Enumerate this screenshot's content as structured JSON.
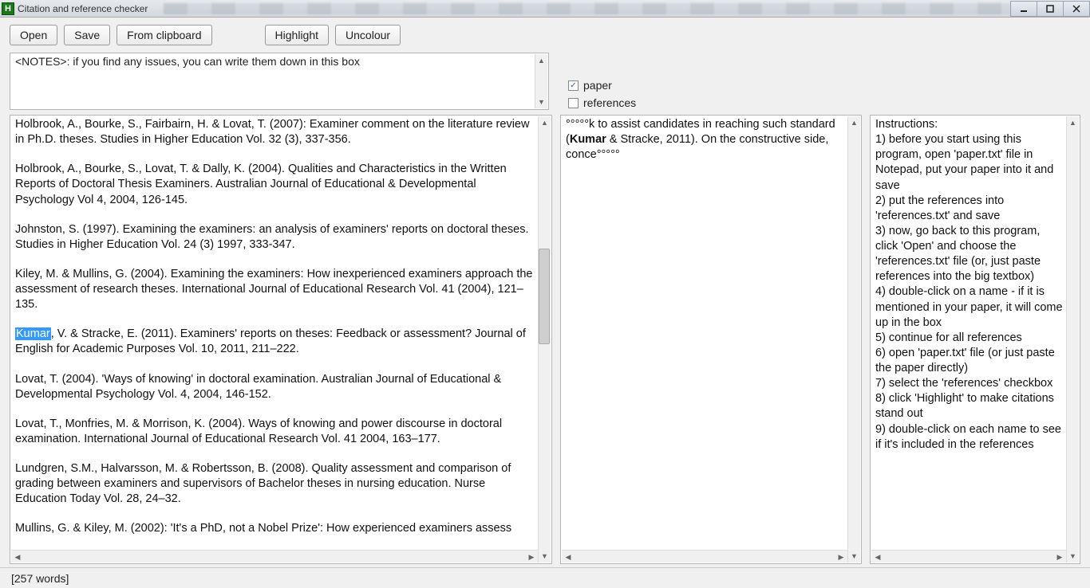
{
  "window": {
    "title": "Citation and reference checker",
    "icon_letter": "H"
  },
  "toolbar": {
    "open": "Open",
    "save": "Save",
    "from_clipboard": "From clipboard",
    "highlight": "Highlight",
    "uncolour": "Uncolour"
  },
  "notes": {
    "text": "<NOTES>: if you find any issues, you can write them down in this box"
  },
  "checks": {
    "paper_label": "paper",
    "paper_checked": true,
    "references_label": "references",
    "references_checked": false
  },
  "references_pane": {
    "highlighted_word": "Kumar",
    "items": [
      "Holbrook, A., Bourke, S., Fairbairn, H. & Lovat, T. (2007): Examiner comment on the literature review in Ph.D. theses. Studies in Higher Education Vol. 32 (3), 337-356.",
      "Holbrook, A., Bourke, S., Lovat, T. & Dally, K. (2004). Qualities and Characteristics in the Written Reports of Doctoral Thesis Examiners. Australian Journal of Educational & Developmental Psychology Vol 4, 2004, 126-145.",
      "Johnston, S. (1997). Examining the examiners: an analysis of examiners' reports on doctoral theses. Studies in Higher Education Vol. 24 (3) 1997, 333-347.",
      "Kiley, M. & Mullins, G. (2004). Examining the examiners: How inexperienced examiners approach the assessment of research theses. International Journal of Educational Research Vol. 41 (2004), 121–135.",
      "Kumar, V. & Stracke, E. (2011). Examiners' reports on theses: Feedback or assessment? Journal of English for Academic Purposes Vol. 10, 2011, 211–222.",
      "Lovat, T. (2004). 'Ways of knowing' in doctoral examination. Australian Journal of Educational & Developmental Psychology Vol. 4, 2004, 146-152.",
      "Lovat, T., Monfries, M. & Morrison, K. (2004). Ways of knowing and power discourse in doctoral examination. International Journal of Educational Research Vol. 41 2004, 163–177.",
      "Lundgren, S.M., Halvarsson, M. & Robertsson, B. (2008). Quality assessment and comparison of grading between examiners and supervisors of Bachelor theses in nursing education. Nurse Education Today Vol. 28, 24–32.",
      "Mullins, G. & Kiley, M. (2002): 'It's a PhD, not a Nobel Prize': How experienced examiners assess"
    ]
  },
  "paper_pane": {
    "pre": "°°°°°k to assist candidates in reaching such standard (",
    "bold": "Kumar",
    "post": " & Stracke, 2011). On the constructive side, conce°°°°°"
  },
  "instructions": {
    "heading": "Instructions:",
    "lines": [
      "1) before you start using this program, open 'paper.txt' file in Notepad, put your paper into it and save",
      "2) put the references into 'references.txt' and save",
      "3) now, go back to this program, click 'Open' and choose the 'references.txt' file (or, just paste references into the big textbox)",
      "4) double-click on a name - if it is mentioned in your paper, it will come up in the box",
      "5) continue for all references",
      "6) open 'paper.txt' file (or just paste the paper directly)",
      "7) select the 'references' checkbox",
      "8) click 'Highlight' to make citations stand out",
      "9) double-click on each name to see if it's included in the references"
    ]
  },
  "status": {
    "text": "[257 words]"
  }
}
